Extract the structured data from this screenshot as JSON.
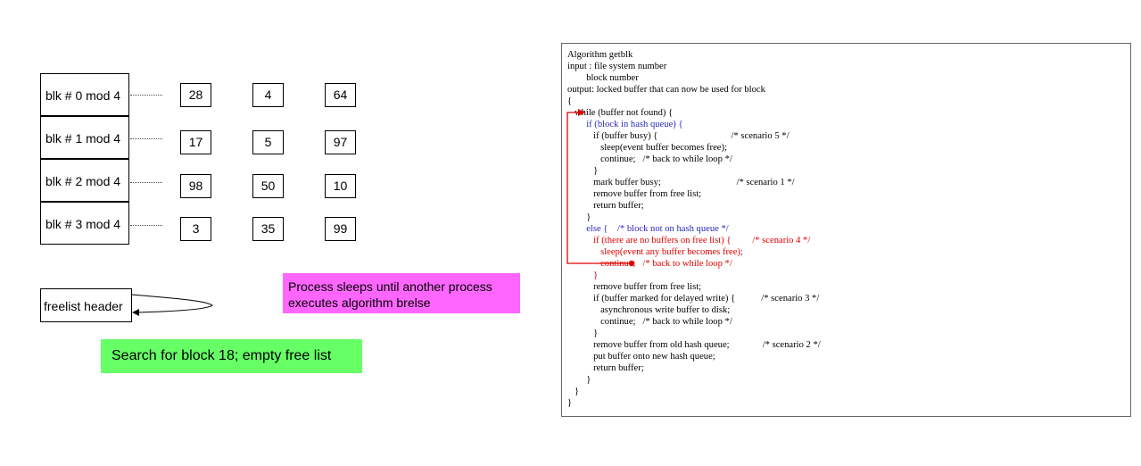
{
  "hash_queues": [
    {
      "label": "blk # 0 mod 4",
      "buffers": [
        "28",
        "4",
        "64"
      ]
    },
    {
      "label": "blk # 1 mod 4",
      "buffers": [
        "17",
        "5",
        "97"
      ]
    },
    {
      "label": "blk # 2 mod 4",
      "buffers": [
        "98",
        "50",
        "10"
      ]
    },
    {
      "label": "blk # 3 mod 4",
      "buffers": [
        "3",
        "35",
        "99"
      ]
    }
  ],
  "freelist_header": "freelist header",
  "note_sleep": "Process sleeps until another process executes algorithm brelse",
  "note_search": "Search for block 18; empty free list",
  "colors": {
    "note_sleep": "#ff66ff",
    "note_search": "#66ff66",
    "code_blue": "#2a2ab8",
    "code_red": "#e00000"
  },
  "algorithm": [
    {
      "text": "Algorithm getblk",
      "color": "black"
    },
    {
      "text": "input : file system number",
      "color": "black"
    },
    {
      "text": "        block number",
      "color": "black"
    },
    {
      "text": "output: locked buffer that can now be used for block",
      "color": "black"
    },
    {
      "text": "{",
      "color": "black"
    },
    {
      "text": "   while (buffer not found) {",
      "color": "black"
    },
    {
      "text": "        if (block in hash queue) {",
      "color": "blue"
    },
    {
      "text": "           if (buffer busy) {                               /* scenario 5 */",
      "color": "black"
    },
    {
      "text": "              sleep(event buffer becomes free);",
      "color": "black"
    },
    {
      "text": "              continue;   /* back to while loop */",
      "color": "black"
    },
    {
      "text": "           }",
      "color": "black"
    },
    {
      "text": "           mark buffer busy;                                /* scenario 1 */",
      "color": "black"
    },
    {
      "text": "           remove buffer from free list;",
      "color": "black"
    },
    {
      "text": "           return buffer;",
      "color": "black"
    },
    {
      "text": "        }",
      "color": "black"
    },
    {
      "text": "        else {    /* block not on hash queue */",
      "color": "blue"
    },
    {
      "text": "           if (there are no buffers on free list) {         /* scenario 4 */",
      "color": "red"
    },
    {
      "text": "              sleep(event any buffer becomes free);",
      "color": "red"
    },
    {
      "text": "              continue;   /* back to while loop */",
      "color": "red"
    },
    {
      "text": "           }",
      "color": "red"
    },
    {
      "text": "           remove buffer from free list;",
      "color": "black"
    },
    {
      "text": "           if (buffer marked for delayed write) {           /* scenario 3 */",
      "color": "black"
    },
    {
      "text": "              asynchronous write buffer to disk;",
      "color": "black"
    },
    {
      "text": "              continue;   /* back to while loop */",
      "color": "black"
    },
    {
      "text": "           }",
      "color": "black"
    },
    {
      "text": "           remove buffer from old hash queue;              /* scenario 2 */",
      "color": "black"
    },
    {
      "text": "           put buffer onto new hash queue;",
      "color": "black"
    },
    {
      "text": "           return buffer;",
      "color": "black"
    },
    {
      "text": "        }",
      "color": "black"
    },
    {
      "text": "   }",
      "color": "black"
    },
    {
      "text": "}",
      "color": "black"
    }
  ]
}
